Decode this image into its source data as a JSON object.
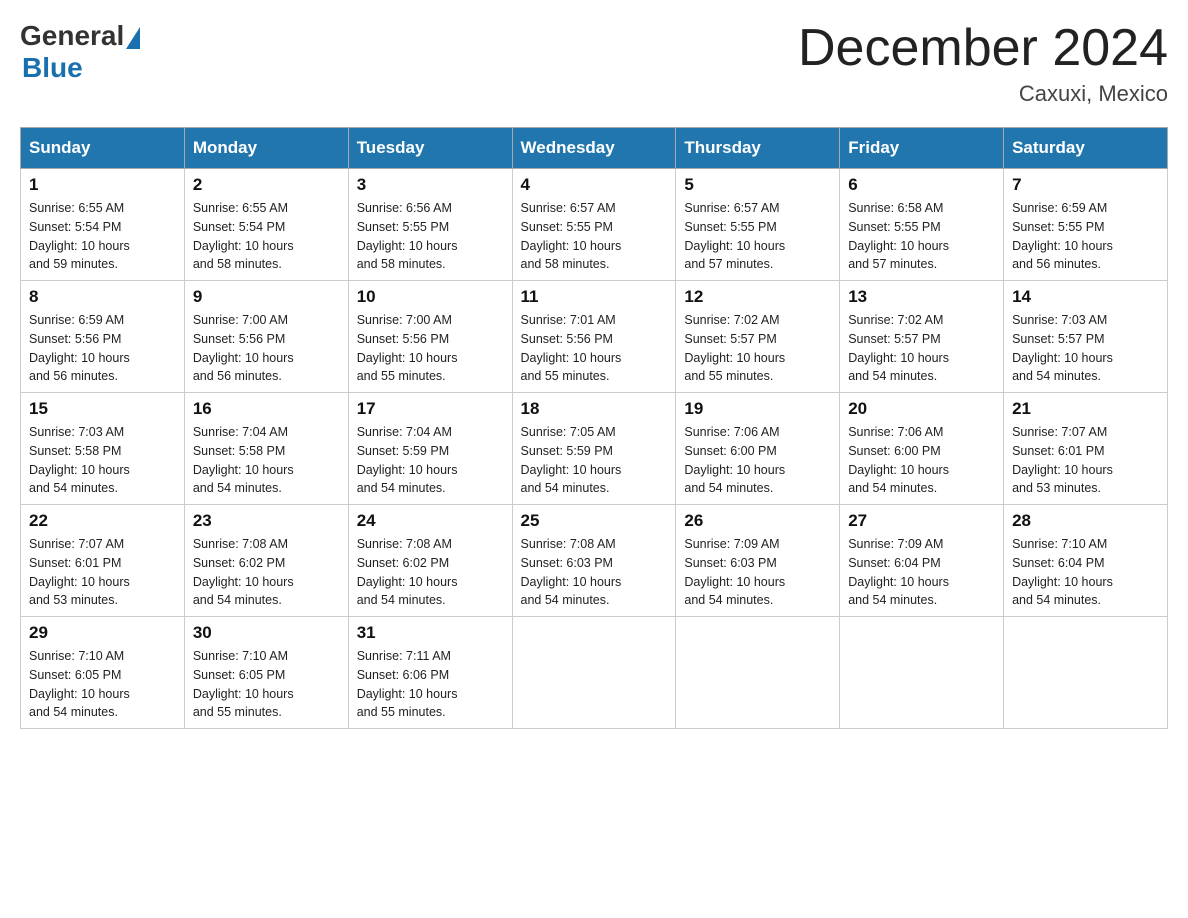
{
  "header": {
    "logo_general": "General",
    "logo_blue": "Blue",
    "month_title": "December 2024",
    "location": "Caxuxi, Mexico"
  },
  "weekdays": [
    "Sunday",
    "Monday",
    "Tuesday",
    "Wednesday",
    "Thursday",
    "Friday",
    "Saturday"
  ],
  "weeks": [
    [
      {
        "day": "1",
        "sunrise": "6:55 AM",
        "sunset": "5:54 PM",
        "daylight": "10 hours and 59 minutes."
      },
      {
        "day": "2",
        "sunrise": "6:55 AM",
        "sunset": "5:54 PM",
        "daylight": "10 hours and 58 minutes."
      },
      {
        "day": "3",
        "sunrise": "6:56 AM",
        "sunset": "5:55 PM",
        "daylight": "10 hours and 58 minutes."
      },
      {
        "day": "4",
        "sunrise": "6:57 AM",
        "sunset": "5:55 PM",
        "daylight": "10 hours and 58 minutes."
      },
      {
        "day": "5",
        "sunrise": "6:57 AM",
        "sunset": "5:55 PM",
        "daylight": "10 hours and 57 minutes."
      },
      {
        "day": "6",
        "sunrise": "6:58 AM",
        "sunset": "5:55 PM",
        "daylight": "10 hours and 57 minutes."
      },
      {
        "day": "7",
        "sunrise": "6:59 AM",
        "sunset": "5:55 PM",
        "daylight": "10 hours and 56 minutes."
      }
    ],
    [
      {
        "day": "8",
        "sunrise": "6:59 AM",
        "sunset": "5:56 PM",
        "daylight": "10 hours and 56 minutes."
      },
      {
        "day": "9",
        "sunrise": "7:00 AM",
        "sunset": "5:56 PM",
        "daylight": "10 hours and 56 minutes."
      },
      {
        "day": "10",
        "sunrise": "7:00 AM",
        "sunset": "5:56 PM",
        "daylight": "10 hours and 55 minutes."
      },
      {
        "day": "11",
        "sunrise": "7:01 AM",
        "sunset": "5:56 PM",
        "daylight": "10 hours and 55 minutes."
      },
      {
        "day": "12",
        "sunrise": "7:02 AM",
        "sunset": "5:57 PM",
        "daylight": "10 hours and 55 minutes."
      },
      {
        "day": "13",
        "sunrise": "7:02 AM",
        "sunset": "5:57 PM",
        "daylight": "10 hours and 54 minutes."
      },
      {
        "day": "14",
        "sunrise": "7:03 AM",
        "sunset": "5:57 PM",
        "daylight": "10 hours and 54 minutes."
      }
    ],
    [
      {
        "day": "15",
        "sunrise": "7:03 AM",
        "sunset": "5:58 PM",
        "daylight": "10 hours and 54 minutes."
      },
      {
        "day": "16",
        "sunrise": "7:04 AM",
        "sunset": "5:58 PM",
        "daylight": "10 hours and 54 minutes."
      },
      {
        "day": "17",
        "sunrise": "7:04 AM",
        "sunset": "5:59 PM",
        "daylight": "10 hours and 54 minutes."
      },
      {
        "day": "18",
        "sunrise": "7:05 AM",
        "sunset": "5:59 PM",
        "daylight": "10 hours and 54 minutes."
      },
      {
        "day": "19",
        "sunrise": "7:06 AM",
        "sunset": "6:00 PM",
        "daylight": "10 hours and 54 minutes."
      },
      {
        "day": "20",
        "sunrise": "7:06 AM",
        "sunset": "6:00 PM",
        "daylight": "10 hours and 54 minutes."
      },
      {
        "day": "21",
        "sunrise": "7:07 AM",
        "sunset": "6:01 PM",
        "daylight": "10 hours and 53 minutes."
      }
    ],
    [
      {
        "day": "22",
        "sunrise": "7:07 AM",
        "sunset": "6:01 PM",
        "daylight": "10 hours and 53 minutes."
      },
      {
        "day": "23",
        "sunrise": "7:08 AM",
        "sunset": "6:02 PM",
        "daylight": "10 hours and 54 minutes."
      },
      {
        "day": "24",
        "sunrise": "7:08 AM",
        "sunset": "6:02 PM",
        "daylight": "10 hours and 54 minutes."
      },
      {
        "day": "25",
        "sunrise": "7:08 AM",
        "sunset": "6:03 PM",
        "daylight": "10 hours and 54 minutes."
      },
      {
        "day": "26",
        "sunrise": "7:09 AM",
        "sunset": "6:03 PM",
        "daylight": "10 hours and 54 minutes."
      },
      {
        "day": "27",
        "sunrise": "7:09 AM",
        "sunset": "6:04 PM",
        "daylight": "10 hours and 54 minutes."
      },
      {
        "day": "28",
        "sunrise": "7:10 AM",
        "sunset": "6:04 PM",
        "daylight": "10 hours and 54 minutes."
      }
    ],
    [
      {
        "day": "29",
        "sunrise": "7:10 AM",
        "sunset": "6:05 PM",
        "daylight": "10 hours and 54 minutes."
      },
      {
        "day": "30",
        "sunrise": "7:10 AM",
        "sunset": "6:05 PM",
        "daylight": "10 hours and 55 minutes."
      },
      {
        "day": "31",
        "sunrise": "7:11 AM",
        "sunset": "6:06 PM",
        "daylight": "10 hours and 55 minutes."
      },
      null,
      null,
      null,
      null
    ]
  ],
  "labels": {
    "sunrise": "Sunrise:",
    "sunset": "Sunset:",
    "daylight": "Daylight:"
  }
}
